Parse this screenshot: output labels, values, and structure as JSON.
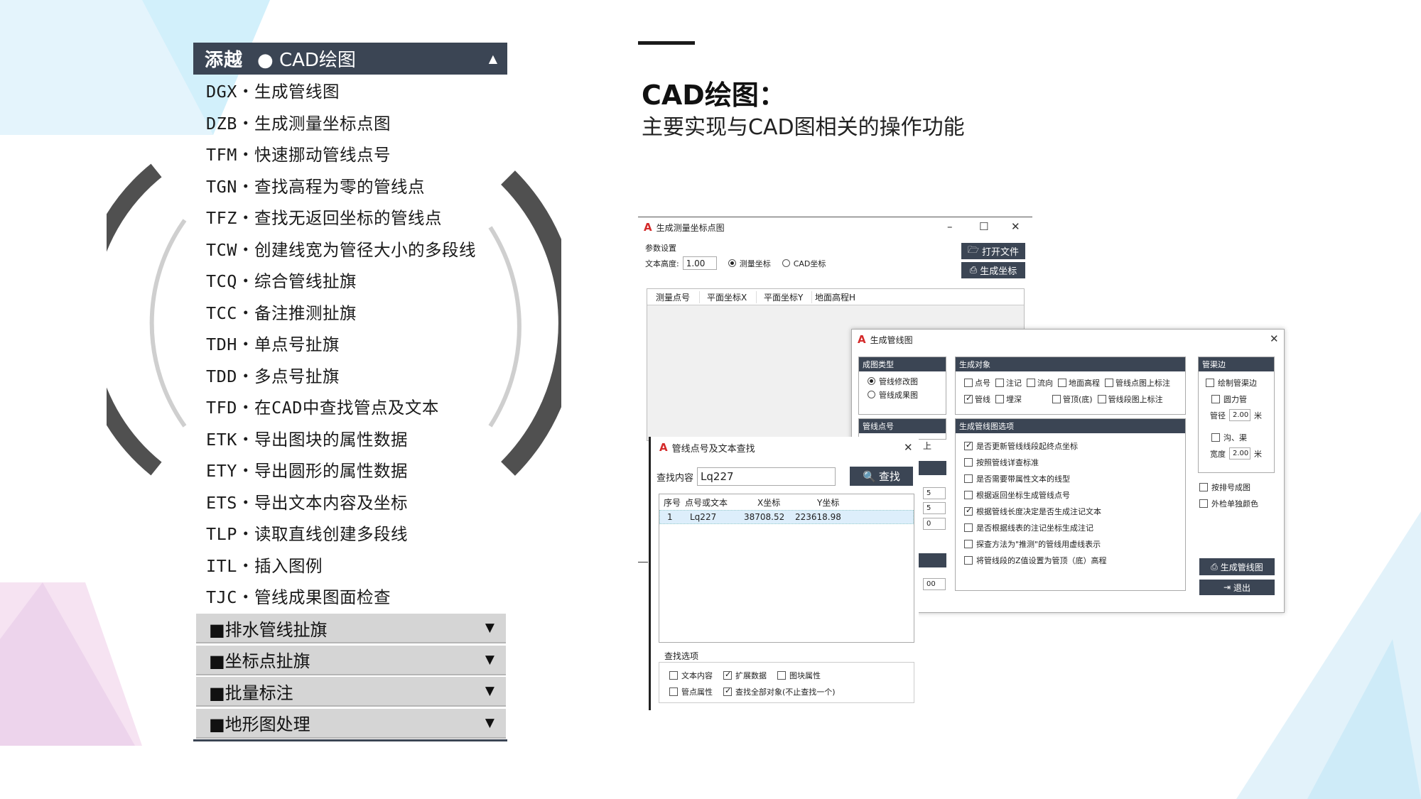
{
  "menu": {
    "addin_label": "添越",
    "header": "● CAD绘图",
    "items": [
      "DGX・生成管线图",
      "DZB・生成测量坐标点图",
      "TFM・快速挪动管线点号",
      "TGN・查找高程为零的管线点",
      "TFZ・查找无返回坐标的管线点",
      "TCW・创建线宽为管径大小的多段线",
      "TCQ・综合管线扯旗",
      "TCC・备注推测扯旗",
      "TDH・单点号扯旗",
      "TDD・多点号扯旗",
      "TFD・在CAD中查找管点及文本",
      "ETK・导出图块的属性数据",
      "ETY・导出圆形的属性数据",
      "ETS・导出文本内容及坐标",
      "TLP・读取直线创建多段线",
      "ITL・插入图例",
      "TJC・管线成果图面检查"
    ],
    "groups": [
      "■排水管线扯旗",
      "■坐标点扯旗",
      "■批量标注",
      "■地形图处理"
    ]
  },
  "title": "CAD绘图：",
  "subtitle": "主要实现与CAD图相关的操作功能",
  "win_survey": {
    "title": "生成测量坐标点图",
    "params_label": "参数设置",
    "text_height_label": "文本高度:",
    "text_height_value": "1.00",
    "radio_survey": "测量坐标",
    "radio_cad": "CAD坐标",
    "open_file": "打开文件",
    "gen_coords": "生成坐标",
    "columns": [
      "测量点号",
      "平面坐标X",
      "平面坐标Y",
      "地面高程H"
    ]
  },
  "win_pipeline": {
    "title": "生成管线图",
    "type_head": "成图类型",
    "type_opt1": "管线修改图",
    "type_opt2": "管线成果图",
    "pointno_head": "管线点号",
    "objects_head": "生成对象",
    "obj_row1": [
      "点号",
      "注记",
      "流向",
      "地面高程",
      "管线点图上标注"
    ],
    "obj_row2": [
      "管线",
      "埋深",
      "管顶(底)",
      "管线段图上标注"
    ],
    "options_head": "生成管线图选项",
    "options": [
      "是否更新管线线段起终点坐标",
      "按照管线详查标准",
      "是否需要带属性文本的线型",
      "根据返回坐标生成管线点号",
      "根据管线长度决定是否生成注记文本",
      "是否根据线表的注记坐标生成注记",
      "探查方法为\"推测\"的管线用虚线表示",
      "将管线段的Z值设置为管顶（底）高程"
    ],
    "edge_head": "管渠边",
    "draw_edge": "绘制管渠边",
    "round_pipe": "圆力管",
    "diameter_label": "管径",
    "diameter_value": "2.00",
    "unit": "米",
    "ditch": "沟、渠",
    "width_label": "宽度",
    "width_value": "2.00",
    "by_number": "按排号成图",
    "outside_color": "外检单独颜色",
    "gen_btn": "生成管线图",
    "exit_btn": "退出",
    "partial_marks": [
      "上",
      "5",
      "5",
      "0",
      "00"
    ]
  },
  "win_find": {
    "title": "管线点号及文本查找",
    "search_label": "查找内容",
    "search_value": "Lq227",
    "search_btn": "查找",
    "columns": [
      "序号",
      "点号或文本",
      "X坐标",
      "Y坐标"
    ],
    "row": [
      "1",
      "Lq227",
      "38708.52",
      "223618.98"
    ],
    "options_head": "查找选项",
    "opt_text": "文本内容",
    "opt_ext": "扩展数据",
    "opt_block": "图块属性",
    "opt_point": "管点属性",
    "opt_all": "查找全部对象(不止查找一个)"
  },
  "colors": {
    "dark": "#3b4554",
    "acad_red": "#d42a2a",
    "ring": "#505050"
  }
}
